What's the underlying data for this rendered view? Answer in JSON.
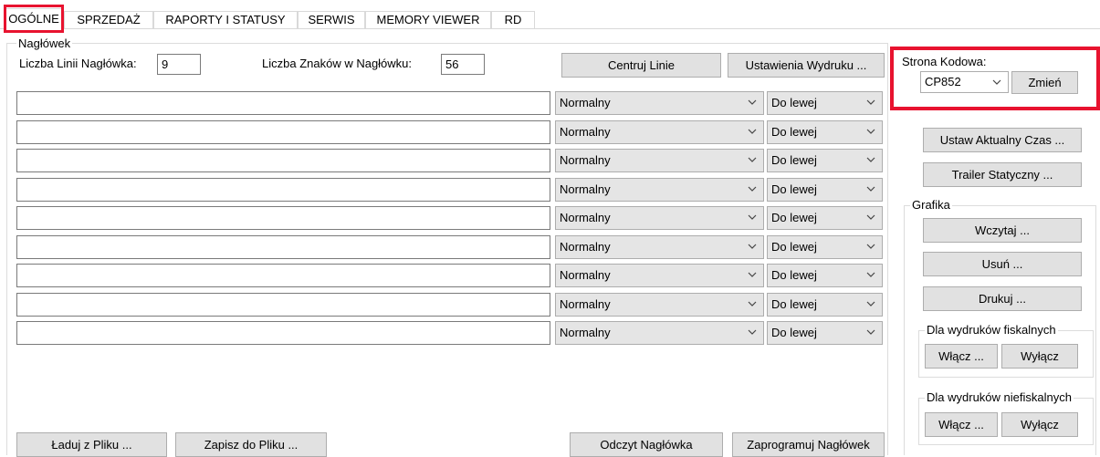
{
  "tabs": [
    {
      "label": "OGÓLNE"
    },
    {
      "label": "SPRZEDAŻ"
    },
    {
      "label": "RAPORTY I STATUSY"
    },
    {
      "label": "SERWIS"
    },
    {
      "label": "MEMORY VIEWER"
    },
    {
      "label": "RD"
    }
  ],
  "header_group": {
    "title": "Nagłówek",
    "lines_label": "Liczba Linii Nagłówka:",
    "lines_value": "9",
    "chars_label": "Liczba Znaków w Nagłówku:",
    "chars_value": "56",
    "center_button": "Centruj Linie",
    "print_settings_button": "Ustawienia Wydruku ..."
  },
  "rows": [
    {
      "text": "",
      "style": "Normalny",
      "align": "Do lewej"
    },
    {
      "text": "",
      "style": "Normalny",
      "align": "Do lewej"
    },
    {
      "text": "",
      "style": "Normalny",
      "align": "Do lewej"
    },
    {
      "text": "",
      "style": "Normalny",
      "align": "Do lewej"
    },
    {
      "text": "",
      "style": "Normalny",
      "align": "Do lewej"
    },
    {
      "text": "",
      "style": "Normalny",
      "align": "Do lewej"
    },
    {
      "text": "",
      "style": "Normalny",
      "align": "Do lewej"
    },
    {
      "text": "",
      "style": "Normalny",
      "align": "Do lewej"
    },
    {
      "text": "",
      "style": "Normalny",
      "align": "Do lewej"
    }
  ],
  "bottom_buttons": {
    "load": "Ładuj z Pliku ...",
    "save": "Zapisz do Pliku ...",
    "read": "Odczyt Nagłówka",
    "program": "Zaprogramuj Nagłówek"
  },
  "codepage": {
    "title": "Strona Kodowa:",
    "value": "CP852",
    "change_button": "Zmień"
  },
  "right_buttons": {
    "set_time": "Ustaw Aktualny Czas ...",
    "static_trailer": "Trailer Statyczny ..."
  },
  "graphics": {
    "title": "Grafika",
    "load": "Wczytaj ...",
    "delete": "Usuń ...",
    "print": "Drukuj ...",
    "fiscal": {
      "title": "Dla wydruków fiskalnych",
      "on": "Włącz ...",
      "off": "Wyłącz"
    },
    "nonfiscal": {
      "title": "Dla wydruków niefiskalnych",
      "on": "Włącz ...",
      "off": "Wyłącz"
    }
  },
  "colors": {
    "highlight": "#e8132f",
    "button_bg": "#e1e1e1",
    "combo_bg": "#e5e5e5"
  }
}
